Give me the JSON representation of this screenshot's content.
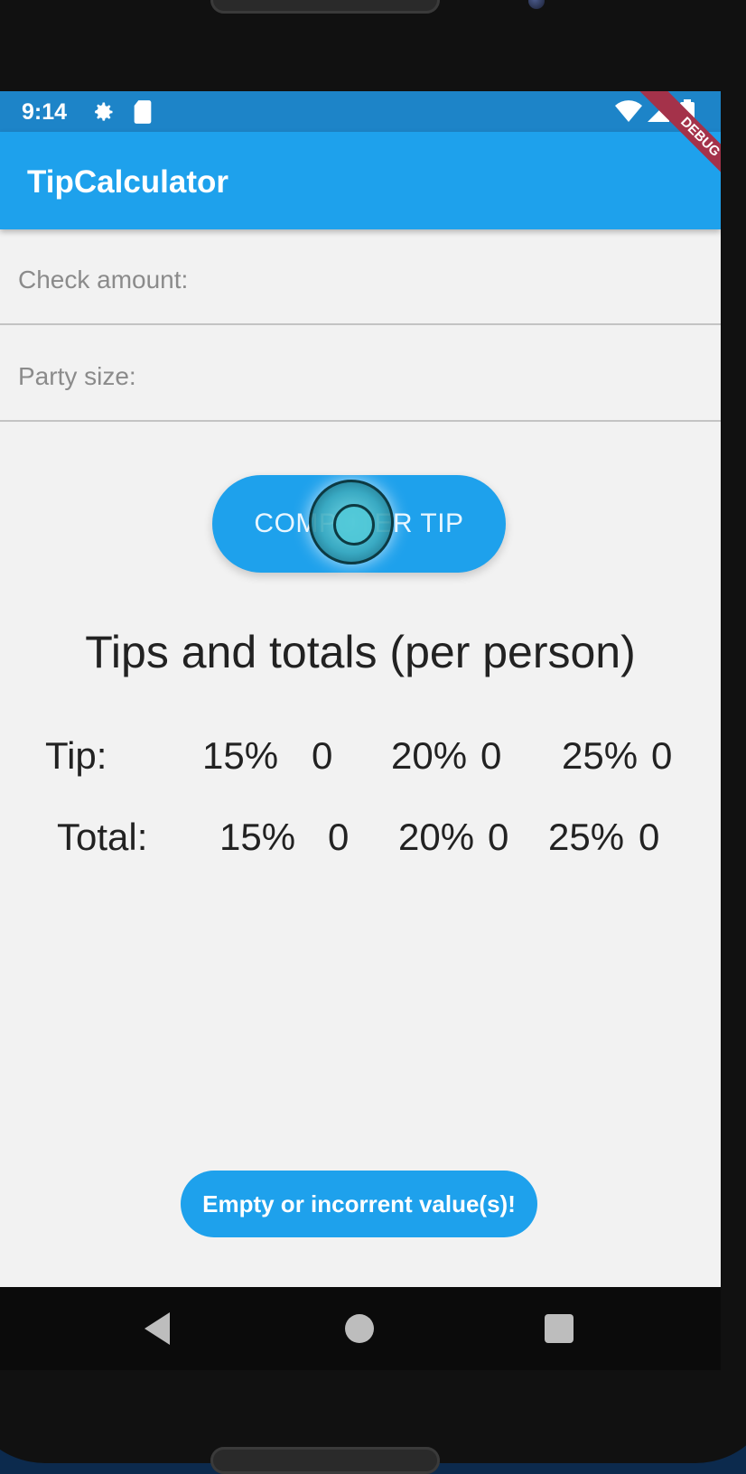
{
  "status": {
    "time": "9:14",
    "icons": [
      "gear-icon",
      "sd-card-icon",
      "wifi-icon",
      "signal-icon",
      "battery-icon"
    ]
  },
  "app": {
    "title": "TipCalculator",
    "debug_banner": "DEBUG",
    "accent_color": "#1ea1ec"
  },
  "form": {
    "check_amount_placeholder": "Check amount:",
    "check_amount_value": "",
    "party_size_placeholder": "Party size:",
    "party_size_value": ""
  },
  "compute_button": {
    "label": "COMPUTER TIP"
  },
  "results": {
    "heading": "Tips and totals (per person)",
    "tip": {
      "label": "Tip:",
      "p15_label": "15%",
      "p15_value": "0",
      "p20_label": "20%",
      "p20_value": "0",
      "p25_label": "25%",
      "p25_value": "0"
    },
    "total": {
      "label": "Total:",
      "p15_label": "15%",
      "p15_value": "0",
      "p20_label": "20%",
      "p20_value": "0",
      "p25_label": "25%",
      "p25_value": "0"
    }
  },
  "toast": {
    "message": "Empty or incorrent value(s)!"
  },
  "navbar": {
    "icons": [
      "back-icon",
      "home-icon",
      "recent-apps-icon"
    ]
  }
}
